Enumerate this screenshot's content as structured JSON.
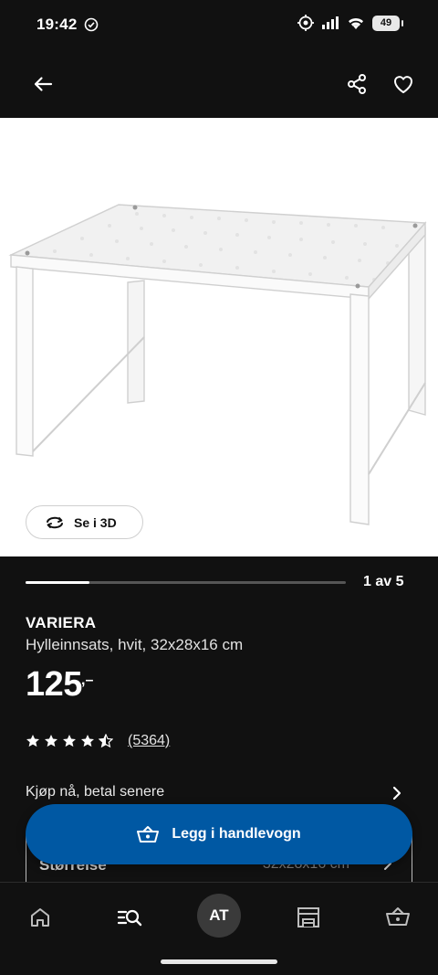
{
  "status_bar": {
    "time": "19:42",
    "battery": "49"
  },
  "header": {
    "back_icon": "arrow-left-icon",
    "share_icon": "share-icon",
    "favorite_icon": "heart-icon"
  },
  "gallery": {
    "view_3d_label": "Se i 3D",
    "page_indicator": "1 av 5",
    "progress": 0.2
  },
  "product": {
    "name": "VARIERA",
    "description": "Hylleinnsats, hvit, 32x28x16 cm",
    "price": "125",
    "price_suffix": ",–",
    "rating_value": 4.5,
    "review_count": "(5364)"
  },
  "bnpl": {
    "label": "Kjøp nå, betal senere"
  },
  "size_selector": {
    "label": "Størrelse",
    "value": "32x28x16 cm"
  },
  "cart_button": {
    "label": "Legg i handlevogn"
  },
  "bottom_nav": {
    "items": [
      "home-icon",
      "search-list-icon",
      "account-avatar",
      "store-icon",
      "basket-icon"
    ],
    "avatar_initials": "AT"
  },
  "colors": {
    "background": "#111111",
    "accent": "#0058a3",
    "image_background": "#ffffff"
  }
}
